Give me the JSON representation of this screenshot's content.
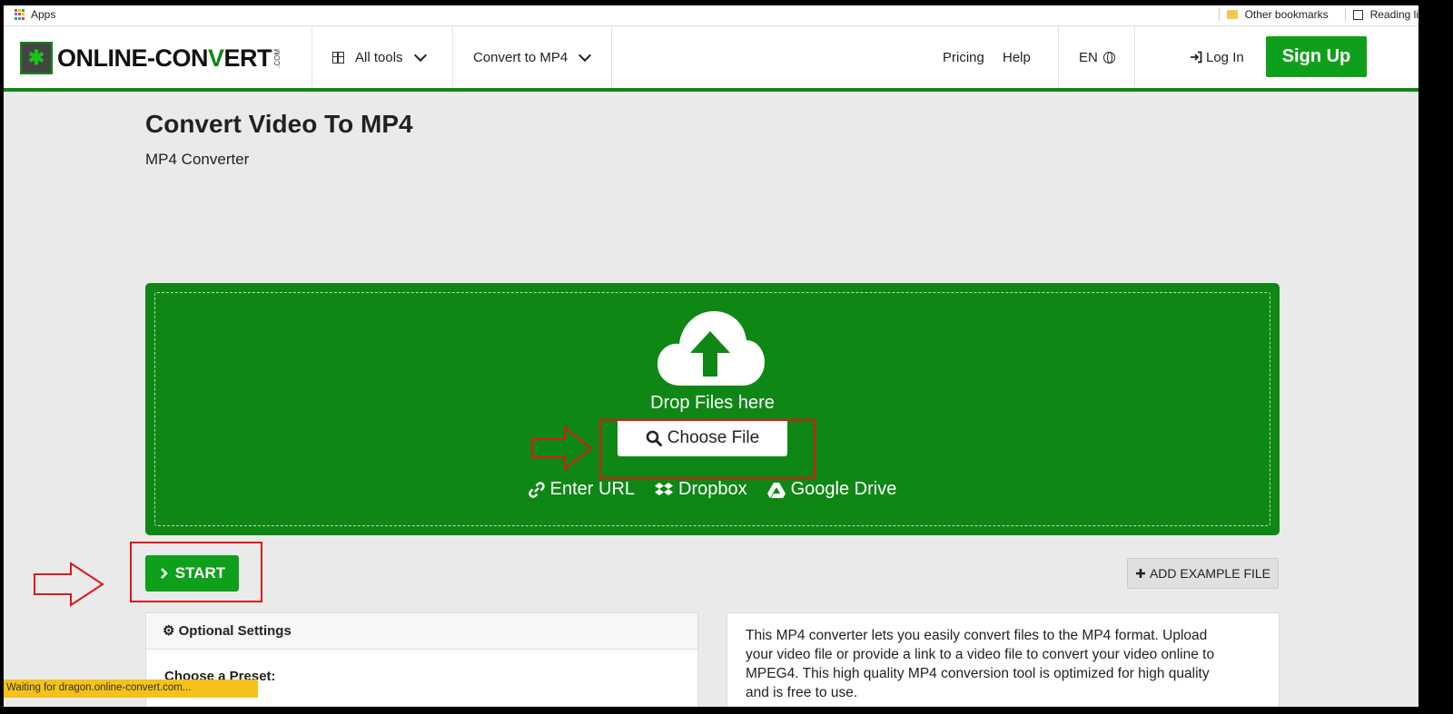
{
  "bookmarks": {
    "apps": "Apps",
    "other": "Other bookmarks",
    "reading": "Reading li"
  },
  "header": {
    "logo": {
      "main": "ONLINE-CON",
      "v": "V",
      "end": "ERT",
      "com": ".COM"
    },
    "all_tools": "All tools",
    "convert_to": "Convert to MP4",
    "pricing": "Pricing",
    "help": "Help",
    "lang": "EN",
    "login": "Log In",
    "signup": "Sign Up",
    "accent": "#0f8715"
  },
  "page": {
    "title": "Convert Video To MP4",
    "subtitle": "MP4 Converter"
  },
  "upload": {
    "drop_text": "Drop Files here",
    "choose": "Choose File",
    "enter_url": "Enter URL",
    "dropbox": "Dropbox",
    "gdrive": "Google Drive",
    "bg": "#0f8715"
  },
  "actions": {
    "start": "START",
    "add_example": "ADD EXAMPLE FILE"
  },
  "settings": {
    "heading": "Optional Settings",
    "preset_label": "Choose a Preset:"
  },
  "description": "This MP4 converter lets you easily convert files to the MP4 format. Upload your video file or provide a link to a video file to convert your video online to MPEG4. This high quality MP4 conversion tool is optimized for high quality and is free to use.",
  "status_bar": "Waiting for dragon.online-convert.com..."
}
